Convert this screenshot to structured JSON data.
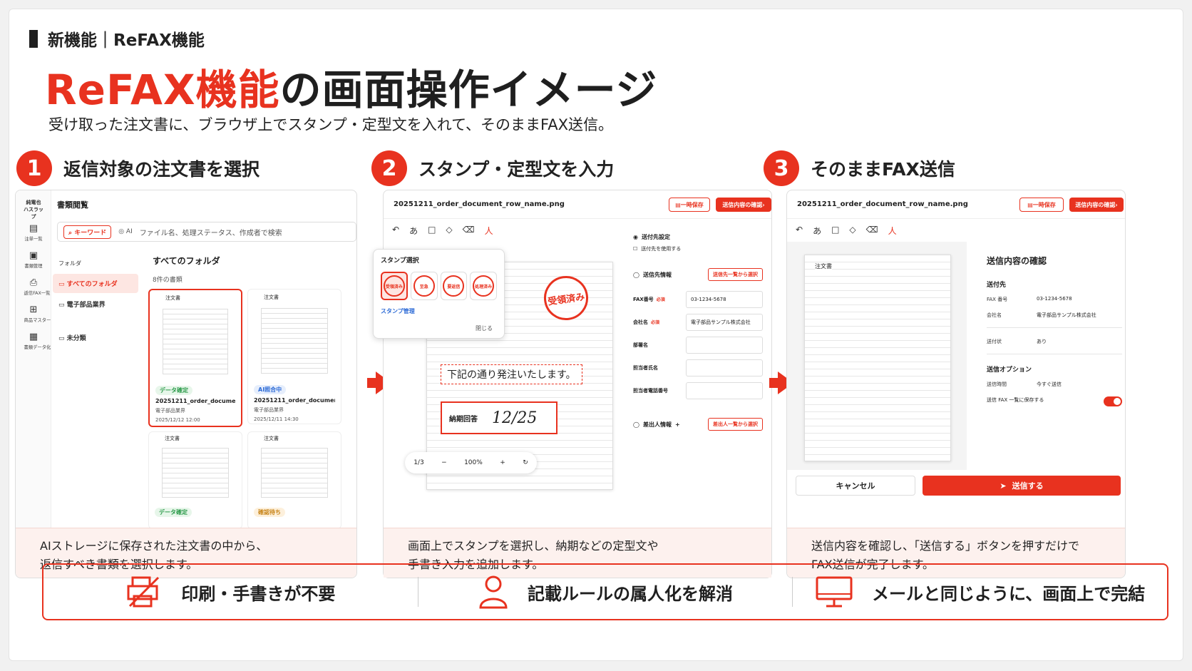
{
  "header": {
    "tag": "新機能｜ReFAX機能",
    "title_accent": "ReFAX機能",
    "title_rest": "の画面操作イメージ",
    "subtitle": "受け取った注文書に、ブラウザ上でスタンプ・定型文を入れて、そのままFAX送信。"
  },
  "steps": [
    {
      "num": "1",
      "title": "返信対象の注文書を選択",
      "desc1": "AIストレージに保存された注文書の中から、",
      "desc2": "返信すべき書類を選択します。"
    },
    {
      "num": "2",
      "title": "スタンプ・定型文を入力",
      "desc1": "画面上でスタンプを選択し、納期などの定型文や",
      "desc2": "手書き入力を追加します。"
    },
    {
      "num": "3",
      "title": "そのままFAX送信",
      "desc1": "送信内容を確認し、「送信する」ボタンを押すだけで",
      "desc2": "FAX送信が完了します。"
    }
  ],
  "panel1": {
    "brand": "純電也 ハスラップ",
    "sidebar": [
      {
        "label": "注単一覧"
      },
      {
        "label": "書類管理"
      },
      {
        "label": "返信FAX一覧"
      },
      {
        "label": "商品マスター"
      },
      {
        "label": "書類データ化"
      }
    ],
    "heading": "書類閲覧",
    "search_chip_keyword": "キーワード",
    "search_chip_ai": "AI",
    "search_placeholder": "ファイル名、処理ステータス、作成者で検索",
    "folder_label": "フォルダ",
    "folders": [
      "すべてのフォルダ",
      "電子部品業界",
      "未分類"
    ],
    "all_folders": "すべてのフォルダ",
    "count": "8件の書類",
    "thumbs": [
      {
        "title": "注文書",
        "badge": "データ確定",
        "name": "20251211_order_document_row...",
        "company": "電子部品業界",
        "date": "2025/12/12 12:00"
      },
      {
        "title": "注文書",
        "badge": "AI照合中",
        "name": "20251211_order_document_row...",
        "company": "電子部品業界",
        "date": "2025/12/11 14:30"
      },
      {
        "title": "注文書",
        "badge": "データ確定"
      },
      {
        "title": "注文書",
        "badge": "確認待ち"
      }
    ]
  },
  "panel2": {
    "filename": "20251211_order_document_row_name.png",
    "temp_save": "一時保存",
    "confirm": "送信内容の確認",
    "tools": [
      "↶",
      "あ",
      "□",
      "◇",
      "⌫",
      "人"
    ],
    "stamp_title": "スタンプ選択",
    "stamps": [
      "受領済み",
      "至急",
      "要返信",
      "処理済み"
    ],
    "stamp_manage": "スタンプ管理",
    "stamp_close": "閉じる",
    "big_stamp": "受領済み",
    "phrase": "下記の通り発注いたします。",
    "due_label": "納期回答",
    "due_value": "12/25",
    "page": "1/3",
    "zoom": "100%",
    "form": {
      "dest_setting": "送付先設定",
      "use_dest": "送付先を使用する",
      "sender_info": "送信先情報",
      "select_from_list": "送信先一覧から選択",
      "fax_label": "FAX番号",
      "required": "必須",
      "fax": "03-1234-5678",
      "company_label": "会社名",
      "company": "電子部品サンプル株式会社",
      "dept_label": "部署名",
      "person_label": "担当者氏名",
      "phone_label": "担当者電話番号",
      "issuer": "差出人情報",
      "issuer_select": "差出人一覧から選択"
    }
  },
  "panel3": {
    "filename": "20251211_order_document_row_name.png",
    "temp_save": "一時保存",
    "confirm": "送信内容の確認",
    "doc_title": "注文書",
    "confirm_title": "送信内容の確認",
    "dest": "送付先",
    "fax_label": "FAX 番号",
    "fax": "03-1234-5678",
    "company_label": "会社名",
    "company": "電子部品サンプル株式会社",
    "cover_label": "送付状",
    "cover": "あり",
    "options": "送信オプション",
    "time_label": "送信時間",
    "time": "今すぐ送信",
    "save_label": "送信 FAX 一覧に保存する",
    "cancel": "キャンセル",
    "send": "送信する"
  },
  "benefits": [
    {
      "label": "印刷・手書きが不要"
    },
    {
      "label": "記載ルールの属人化を解消"
    },
    {
      "label": "メールと同じように、画面上で完結"
    }
  ],
  "colors": {
    "accent": "#e8321f"
  }
}
